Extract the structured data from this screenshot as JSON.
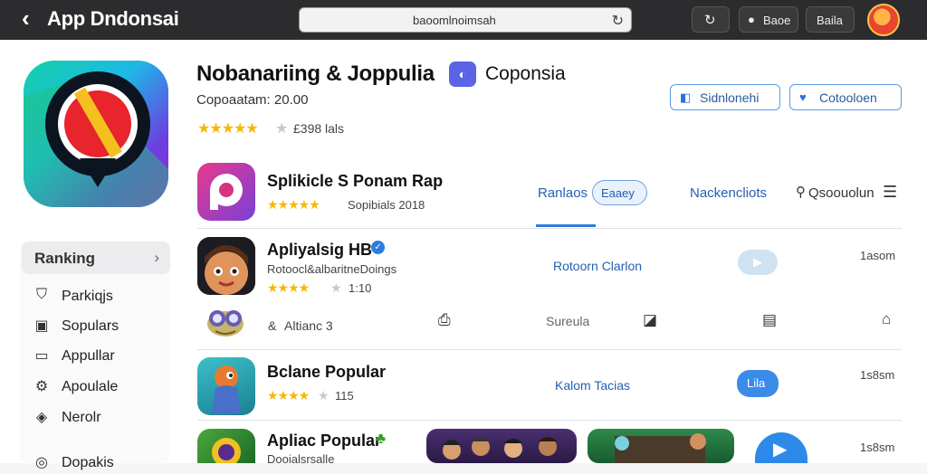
{
  "header": {
    "back_icon": "chevron-left-icon",
    "title": "App Dndonsai",
    "search_value": "baoomlnoimsah",
    "reload_icon": "reload-icon",
    "btn1_icon": "refresh-icon",
    "btn2_icon": "apple-icon",
    "btn2_label": "Baoe",
    "btn3_label": "Baila"
  },
  "app": {
    "name": "Nobanariing & Joppulia",
    "developer": "Coponsia",
    "subline": "Copoaatam: 20.00",
    "rating_text": "£398 lals",
    "stars": "★★★★★",
    "star_empty": "★",
    "btn_share": "Sidnlonehi",
    "btn_follow": "Cotooloen"
  },
  "sidebar": {
    "header": "Ranking",
    "items": [
      {
        "label": "Parkiqjs",
        "icon": "shield-icon"
      },
      {
        "label": "Sopulars",
        "icon": "lock-icon"
      },
      {
        "label": "Appullar",
        "icon": "window-icon"
      },
      {
        "label": "Apoulale",
        "icon": "gear-icon"
      },
      {
        "label": "Nerolr",
        "icon": "shield-outline-icon"
      },
      {
        "label": "Dopakis",
        "icon": "circle-icon"
      }
    ]
  },
  "nav": {
    "tab1": "Ranlaos",
    "tab1_badge": "Eaaey",
    "tab2": "Nackencliots",
    "tab3": "Qsoouolun"
  },
  "rows": [
    {
      "title": "Splikicle S Ponam Rap",
      "stars": "★★★★★",
      "meta": "Sopibials   2018"
    },
    {
      "title": "Apliyalsig HB",
      "sub": "Rotoocl&albaritneDoings",
      "stars": "★★★★",
      "star_empty": "★",
      "meta": "1:10",
      "link": "Rotoorn Clarlon",
      "size": "1asom"
    },
    {
      "sub_label": "Altianc 3",
      "sub_prefix": "&",
      "tag": "Sureula"
    },
    {
      "title": "Bclane Popular",
      "stars": "★★★★",
      "star_empty": "★",
      "meta": "115",
      "link": "Kalom Tacias",
      "pill": "Lila",
      "size": "1s8sm"
    },
    {
      "title": "Apliac Popular",
      "sub": "Dooialsrsalle",
      "size": "1s8sm"
    }
  ]
}
